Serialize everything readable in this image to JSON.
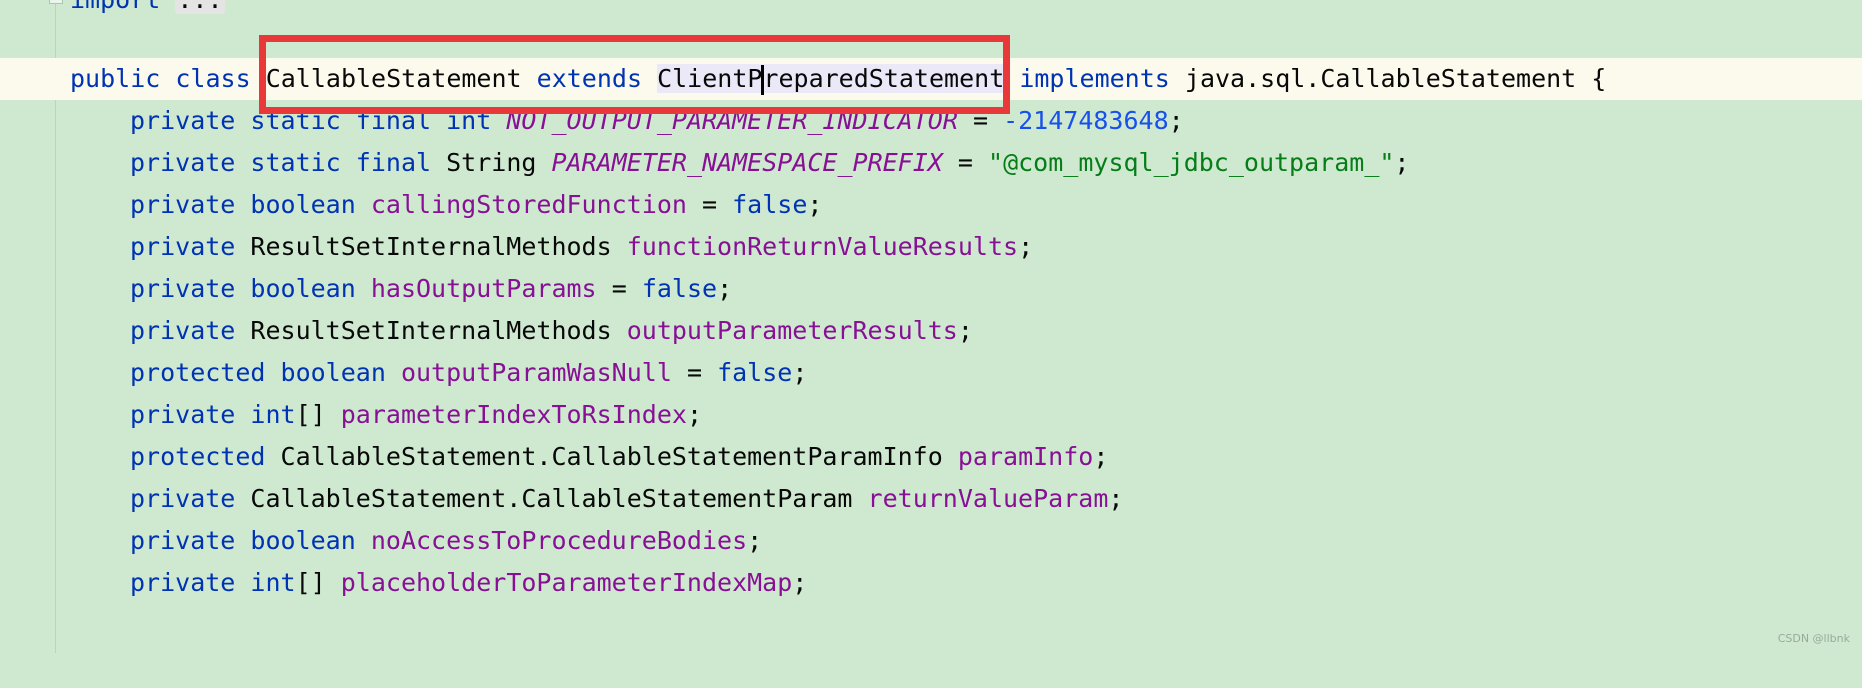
{
  "editor": {
    "lines": {
      "import": {
        "kw": "import",
        "folded": "..."
      },
      "class_decl": {
        "kw_public": "public",
        "kw_class": "class",
        "class_name": "CallableStatement",
        "kw_extends": "extends",
        "super_a": "ClientP",
        "super_b": "reparedStatement",
        "kw_implements": "implements",
        "interface": "java.sql.CallableStatement",
        "brace": "{"
      },
      "f1": {
        "mod1": "private",
        "mod2": "static",
        "mod3": "final",
        "type": "int",
        "name": "NOT_OUTPUT_PARAMETER_INDICATOR",
        "eq": "=",
        "value": "-2147483648",
        "end": ";"
      },
      "f2": {
        "mod1": "private",
        "mod2": "static",
        "mod3": "final",
        "type": "String",
        "name": "PARAMETER_NAMESPACE_PREFIX",
        "eq": "=",
        "value": "\"@com_mysql_jdbc_outparam_\"",
        "end": ";"
      },
      "f3": {
        "mod": "private",
        "type": "boolean",
        "name": "callingStoredFunction",
        "eq": "=",
        "value": "false",
        "end": ";"
      },
      "f4": {
        "mod": "private",
        "type": "ResultSetInternalMethods",
        "name": "functionReturnValueResults",
        "end": ";"
      },
      "f5": {
        "mod": "private",
        "type": "boolean",
        "name": "hasOutputParams",
        "eq": "=",
        "value": "false",
        "end": ";"
      },
      "f6": {
        "mod": "private",
        "type": "ResultSetInternalMethods",
        "name": "outputParameterResults",
        "end": ";"
      },
      "f7": {
        "mod": "protected",
        "type": "boolean",
        "name": "outputParamWasNull",
        "eq": "=",
        "value": "false",
        "end": ";"
      },
      "f8": {
        "mod": "private",
        "type": "int",
        "suffix": "[]",
        "name": "parameterIndexToRsIndex",
        "end": ";"
      },
      "f9": {
        "mod": "protected",
        "type": "CallableStatement.CallableStatementParamInfo",
        "name": "paramInfo",
        "end": ";"
      },
      "f10": {
        "mod": "private",
        "type": "CallableStatement.CallableStatementParam",
        "name": "returnValueParam",
        "end": ";"
      },
      "f11": {
        "mod": "private",
        "type": "boolean",
        "name": "noAccessToProcedureBodies",
        "end": ";"
      },
      "f12": {
        "mod": "private",
        "type": "int",
        "suffix": "[]",
        "name": "placeholderToParameterIndexMap",
        "end": ";"
      }
    }
  },
  "colors": {
    "background": "#cfe9d1",
    "current_line": "#fcfaed",
    "keyword": "#0033b3",
    "field": "#871094",
    "string": "#067d17",
    "number": "#1750eb",
    "highlight_border": "#e8383a"
  },
  "watermark": "CSDN @llbnk"
}
